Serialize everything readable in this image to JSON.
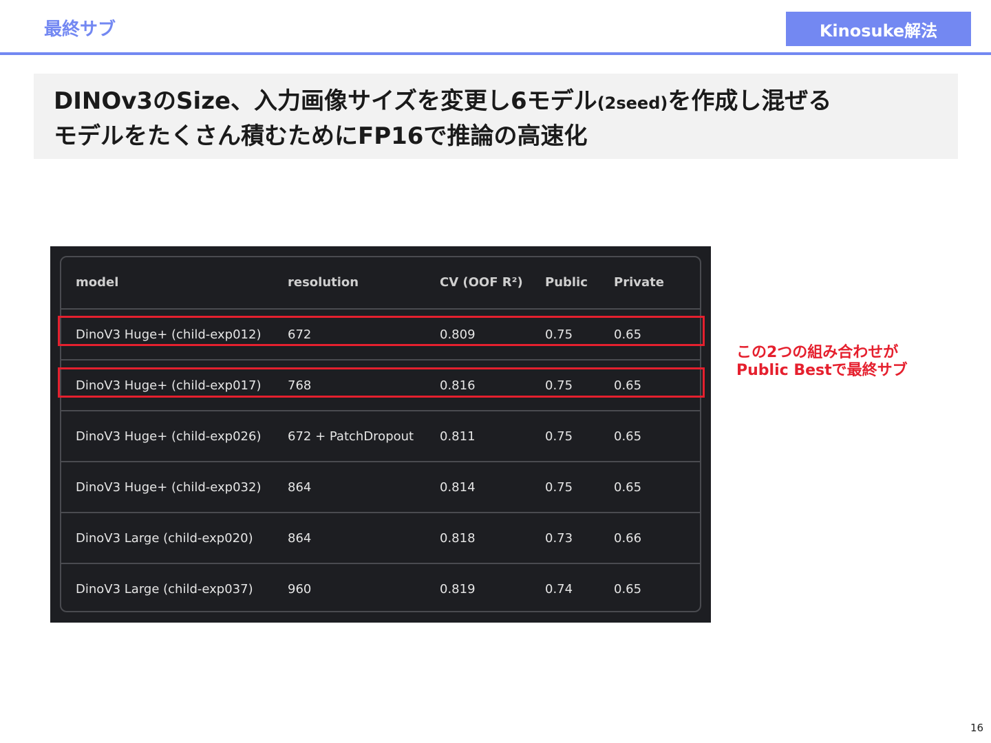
{
  "header": {
    "section_label": "最終サブ",
    "badge": "Kinosuke解法"
  },
  "title": {
    "line1_a": "DINOv3のSize、入力画像サイズを変更し6モデル",
    "line1_small": "(2seed)",
    "line1_b": "を作成し混ぜる",
    "line2": "モデルをたくさん積むためにFP16で推論の高速化"
  },
  "table": {
    "columns": [
      "model",
      "resolution",
      "CV (OOF R²)",
      "Public",
      "Private"
    ],
    "rows": [
      [
        "DinoV3 Huge+ (child-exp012)",
        "672",
        "0.809",
        "0.75",
        "0.65"
      ],
      [
        "DinoV3 Huge+ (child-exp017)",
        "768",
        "0.816",
        "0.75",
        "0.65"
      ],
      [
        "DinoV3 Huge+ (child-exp026)",
        "672 + PatchDropout",
        "0.811",
        "0.75",
        "0.65"
      ],
      [
        "DinoV3 Huge+ (child-exp032)",
        "864",
        "0.814",
        "0.75",
        "0.65"
      ],
      [
        "DinoV3 Large (child-exp020)",
        "864",
        "0.818",
        "0.73",
        "0.66"
      ],
      [
        "DinoV3 Large (child-exp037)",
        "960",
        "0.819",
        "0.74",
        "0.65"
      ]
    ]
  },
  "callout": {
    "line1": "この2つの組み合わせが",
    "line2": "Public Bestで最終サブ"
  },
  "page_number": "16",
  "colors": {
    "accent": "#7388f2",
    "highlight": "#e5202e",
    "table_bg": "#1d1e22"
  }
}
